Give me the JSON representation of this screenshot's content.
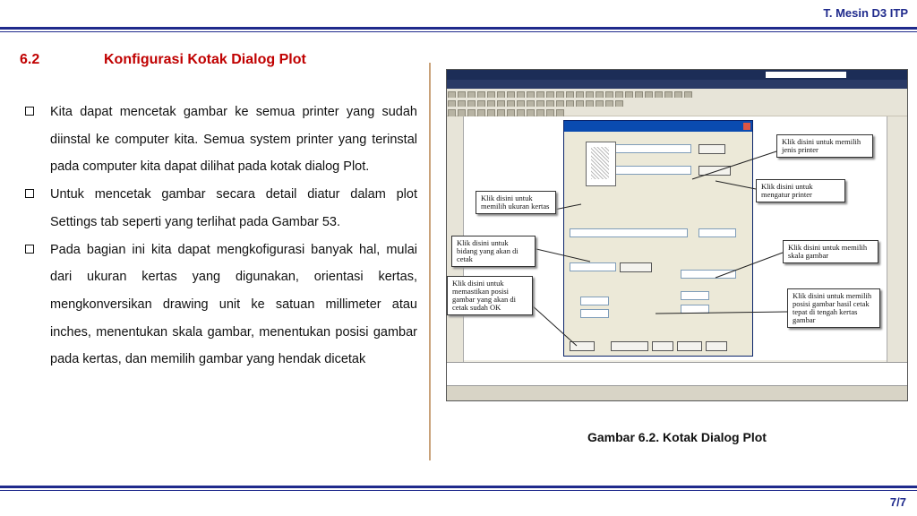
{
  "header": {
    "label": "T. Mesin D3 ITP"
  },
  "section": {
    "number": "6.2",
    "title": "Konfigurasi Kotak Dialog Plot"
  },
  "bullets": [
    "Kita dapat mencetak gambar ke semua printer yang sudah diinstal ke computer kita. Semua system printer yang terinstal pada computer kita dapat dilihat pada kotak dialog Plot.",
    "Untuk mencetak gambar secara detail diatur dalam plot Settings tab seperti yang terlihat pada Gambar 53.",
    " Pada bagian ini kita dapat mengkofigurasi banyak hal, mulai dari ukuran kertas yang digunakan, orientasi kertas, mengkonversikan drawing unit ke satuan millimeter atau inches, menentukan skala gambar, menentukan posisi gambar pada kertas, dan memilih gambar yang hendak dicetak"
  ],
  "figure": {
    "caption": "Gambar 6.2. Kotak Dialog Plot",
    "callouts": {
      "printer": "Klik disini untuk memilih jenis printer",
      "printer_setup": "Klik disini untuk mengatur printer",
      "paper_size": "Klik disini untuk memilih ukuran kertas",
      "plot_area": "Klik disini untuk bidang yang akan di cetak",
      "scale": "Klik disini untuk memilih skala gambar",
      "center": "Klik disini untuk memastikan posisi gambar yang akan di cetak sudah OK",
      "center_plot": "Klik disini untuk memilih posisi gambar hasil cetak tepat di tengah kertas gambar"
    }
  },
  "page": {
    "number": "7/7"
  }
}
